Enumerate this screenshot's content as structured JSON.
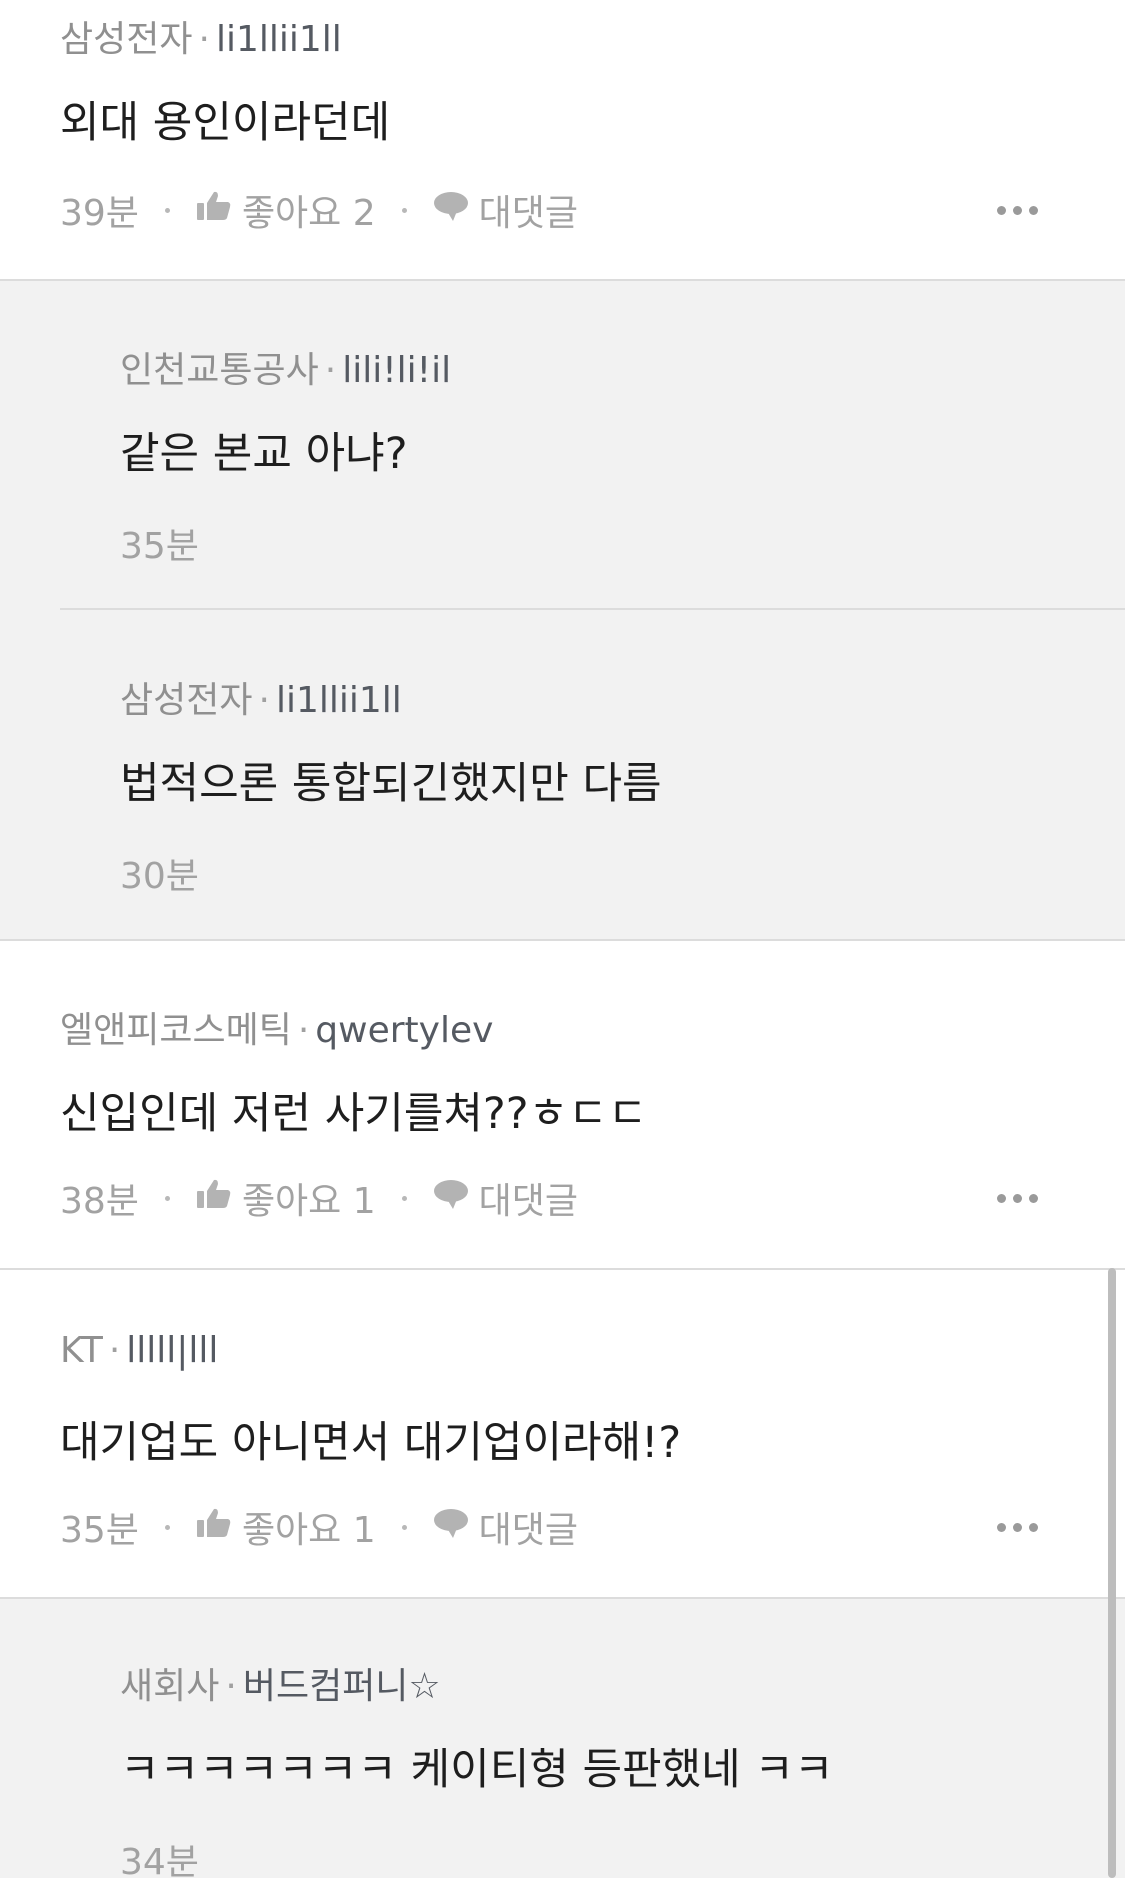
{
  "comments": [
    {
      "company": "삼성전자",
      "nickname": "li1llii1ll",
      "text": "외대 용인이라던데",
      "time": "39분",
      "like_label": "좋아요 2",
      "reply_label": "대댓글"
    },
    {
      "company": "인천교통공사",
      "nickname": "lili!li!il",
      "text": "같은 본교 아냐?",
      "time": "35분"
    },
    {
      "company": "삼성전자",
      "nickname": "li1llii1ll",
      "text": "법적으론 통합되긴했지만 다름",
      "time": "30분"
    },
    {
      "company": "엘앤피코스메틱",
      "nickname": "qwertylev",
      "text": "신입인데 저런 사기를쳐??ㅎㄷㄷ",
      "time": "38분",
      "like_label": "좋아요 1",
      "reply_label": "대댓글"
    },
    {
      "company": "KT",
      "nickname": "lllll|lll",
      "text": "대기업도 아니면서 대기업이라해!?",
      "time": "35분",
      "like_label": "좋아요 1",
      "reply_label": "대댓글"
    },
    {
      "company": "새회사",
      "nickname": "버드컴퍼니☆",
      "text": "ㅋㅋㅋㅋㅋㅋㅋ 케이티형 등판했네 ㅋㅋ",
      "time": "34분"
    }
  ],
  "icons": {
    "like": "thumbs-up-icon",
    "reply": "speech-bubble-icon",
    "more": "more-dots-icon"
  },
  "colors": {
    "reply_background": "#f2f2f2",
    "meta_text": "#909090",
    "divider": "#dcdcdc"
  }
}
